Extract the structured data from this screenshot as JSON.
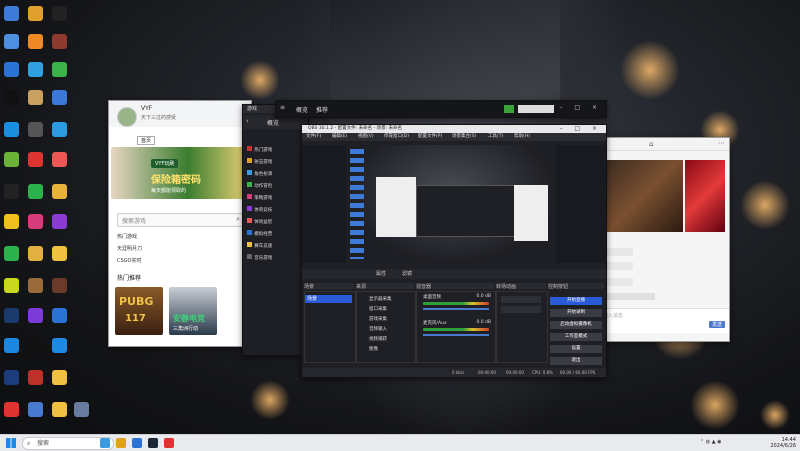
{
  "taskbar": {
    "search_placeholder": "搜索",
    "time": "14:44",
    "date": "2024/6/26"
  },
  "left_window": {
    "username": "VYF",
    "subtitle": "天下三过的感受",
    "tab_selected": "首页",
    "banner_tag": "VYF玩刷",
    "banner_title": "保险箱密码",
    "banner_sub": "每天都能领取的",
    "search_placeholder": "搜索游戏",
    "section_title": "热门推荐",
    "row1": "热门游戏",
    "row2": "天涯明月刀",
    "row3": "CSGO实时",
    "games": [
      {
        "name": "PUBG",
        "sub": "117"
      },
      {
        "name": "安静电竞",
        "sub": "三角洲行动"
      }
    ]
  },
  "obs": {
    "title": "OBS 30.1.2 - 配置文件: 未命名 - 场景: 未命名",
    "menu": [
      "文件(F)",
      "编辑(E)",
      "视图(V)",
      "停靠窗口(D)",
      "配置文件(P)",
      "场景集合(S)",
      "工具(T)",
      "帮助(H)"
    ],
    "tabs": [
      "属性",
      "滤镜"
    ],
    "scenes_header": "场景",
    "scene_item": "场景",
    "sources_header": "来源",
    "mixer_header": "混音器",
    "transitions_header": "转场动画",
    "controls_header": "控制按钮",
    "sources": [
      "显示器采集",
      "窗口采集",
      "游戏采集",
      "音频输入",
      "视频捕获",
      "图像"
    ],
    "mixer_items": [
      "桌面音频",
      "麦克风/Aux"
    ],
    "mixer_db": [
      "0.0 dB",
      "0.0 dB"
    ],
    "controls": [
      "开始直播",
      "开始录制",
      "启动虚拟摄像机",
      "工作室模式",
      "设置",
      "退出"
    ],
    "status": [
      "0 kb/s",
      "00:00:00",
      "00:00:00",
      "CPU: 0.8%",
      "60.00 / 60.00 FPS"
    ]
  },
  "explorer": {
    "title": "游戏",
    "back_label": "概览",
    "tabs": [
      "概览",
      "推荐"
    ],
    "items": [
      "热门游戏",
      "射击游戏",
      "角色扮演",
      "动作冒险",
      "策略游戏",
      "体育竞技",
      "休闲益智",
      "模拟经营",
      "赛车竞速",
      "音乐游戏"
    ]
  },
  "right_window": {
    "input_placeholder": "输入消息",
    "send_label": "发送"
  },
  "colors": {
    "obs_accent": "#2a5bd7",
    "taskbar_bg": "#e9eaee",
    "green_btn": "#3ca23c"
  }
}
